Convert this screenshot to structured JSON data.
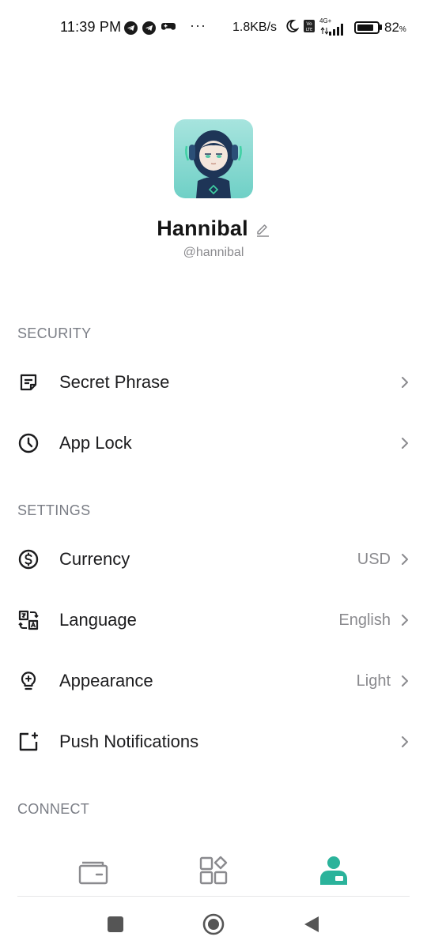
{
  "status_bar": {
    "time": "11:39 PM",
    "more": "···",
    "net_speed": "1.8KB/s",
    "network": "4G+",
    "battery_percent": "82",
    "battery_unit": "%",
    "battery_level": 0.82
  },
  "profile": {
    "name": "Hannibal",
    "handle": "@hannibal"
  },
  "sections": {
    "security": {
      "title": "SECURITY",
      "items": [
        {
          "label": "Secret Phrase",
          "icon": "note-icon"
        },
        {
          "label": "App Lock",
          "icon": "clock-icon"
        }
      ]
    },
    "settings": {
      "title": "SETTINGS",
      "items": [
        {
          "label": "Currency",
          "value": "USD",
          "icon": "dollar-circle-icon"
        },
        {
          "label": "Language",
          "value": "English",
          "icon": "translate-icon"
        },
        {
          "label": "Appearance",
          "value": "Light",
          "icon": "lightbulb-icon"
        },
        {
          "label": "Push Notifications",
          "icon": "notification-icon"
        }
      ]
    },
    "connect": {
      "title": "CONNECT"
    }
  },
  "bottom_nav": {
    "items": [
      {
        "icon": "wallet-icon",
        "active": false
      },
      {
        "icon": "apps-grid-icon",
        "active": false
      },
      {
        "icon": "profile-icon",
        "active": true
      }
    ]
  },
  "colors": {
    "accent": "#2bb39b",
    "text_primary": "#1c1c1e",
    "text_secondary": "#8a8a8e",
    "section_title": "#7a7d85"
  }
}
